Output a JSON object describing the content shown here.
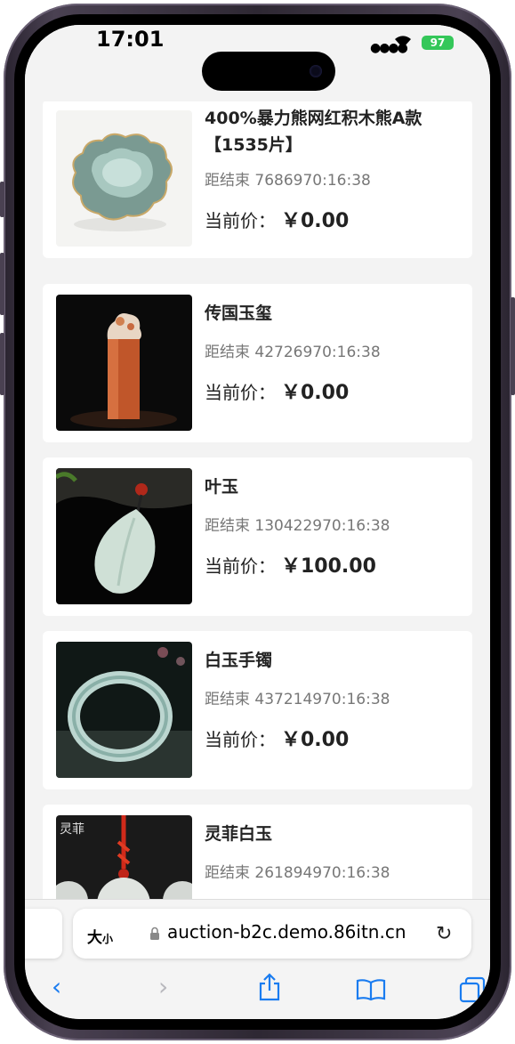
{
  "status": {
    "time": "17:01",
    "battery": "97"
  },
  "items": [
    {
      "title": "400%暴力熊网红积木熊A款【1535片】",
      "countdown": "距结束 7686970:16:38",
      "price_label": "当前价：",
      "price": "￥0.00"
    },
    {
      "title": "传国玉玺",
      "countdown": "距结束 42726970:16:38",
      "price_label": "当前价：",
      "price": "￥0.00"
    },
    {
      "title": "叶玉",
      "countdown": "距结束 130422970:16:38",
      "price_label": "当前价：",
      "price": "￥100.00"
    },
    {
      "title": "白玉手镯",
      "countdown": "距结束 437214970:16:38",
      "price_label": "当前价：",
      "price": "￥0.00"
    },
    {
      "title": "灵菲白玉",
      "countdown": "距结束 261894970:16:38",
      "thumb_caption": "灵菲"
    }
  ],
  "browser": {
    "text_size_label": "大",
    "text_size_small": "小",
    "url": "auction-b2c.demo.86itn.cn"
  },
  "colors": {
    "accent": "#1a7cf0",
    "disabled": "#b8b8bd"
  }
}
